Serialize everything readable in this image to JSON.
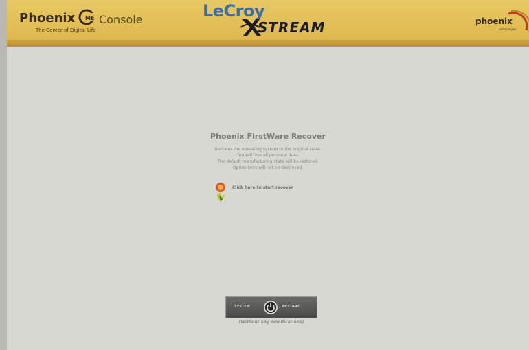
{
  "header": {
    "phoenix_name": "Phoenix",
    "phoenix_console": "Console",
    "phoenix_tagline": "The Center of Digital Life",
    "me_icon_label": "ME",
    "lecroy": "LeCroy",
    "xstream": "STREAM",
    "phoenix_tech_name": "phoenix",
    "phoenix_tech_sub": "technologies"
  },
  "main": {
    "title": "Phoenix FirstWare Recover",
    "description": [
      "Restores the operating system to the original state.",
      "You will lose all personal data.",
      "The default manufacturing state will be restored.",
      "Option keys will not be destroyed."
    ],
    "start_label": "Click here to start recover",
    "start_icon": "recover-icon"
  },
  "restart": {
    "left_label": "SYSTEM",
    "right_label": "RESTART",
    "icon": "power-icon",
    "note": "(Without any modifications)"
  },
  "colors": {
    "header_gold": "#e2bf58",
    "background": "#d7d7d2",
    "lecroy_blue": "#3c6da8"
  }
}
